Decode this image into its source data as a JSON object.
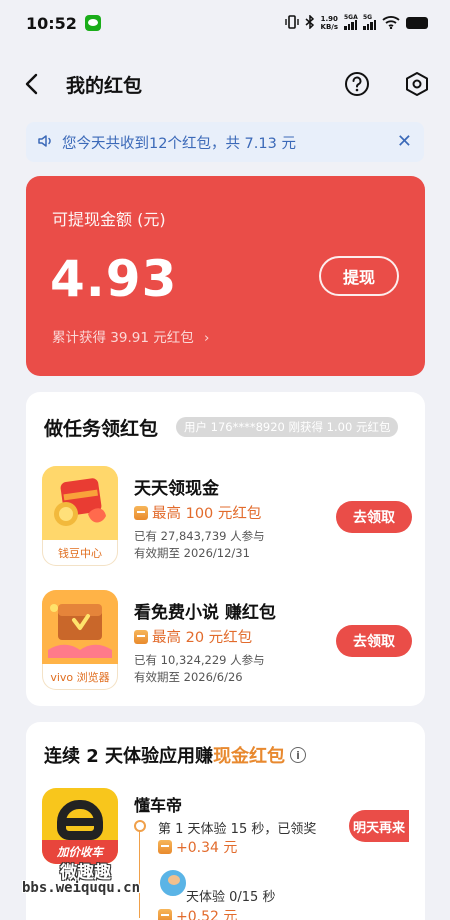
{
  "status_bar": {
    "time": "10:52",
    "net_speed": "1.90",
    "net_unit": "KB/s",
    "signal1": "5GA",
    "signal2": "5G"
  },
  "header": {
    "title": "我的红包"
  },
  "notice": {
    "text": "您今天共收到12个红包，共 7.13 元"
  },
  "balance": {
    "label": "可提现金额 (元)",
    "amount": "4.93",
    "withdraw_label": "提现",
    "accumulated_text": "累计获得 39.91 元红包"
  },
  "tasks": {
    "title": "做任务领红包",
    "ticker": "用户 176****8920 刚获得 1.00 元红包",
    "items": [
      {
        "icon_label": "钱豆中心",
        "name": "天天领现金",
        "reward": "最高 100 元红包",
        "participants": "已有 27,843,739 人参与",
        "validity": "有效期至 2026/12/31",
        "button": "去领取"
      },
      {
        "icon_label": "vivo 浏览器",
        "name": "看免费小说 赚红包",
        "reward": "最高 20 元红包",
        "participants": "已有 10,324,229 人参与",
        "validity": "有效期至 2026/6/26",
        "button": "去领取"
      }
    ]
  },
  "consecutive": {
    "title_prefix": "连续 2 天体验应用赚",
    "title_highlight": "现金红包",
    "app_name": "懂车帝",
    "app_banner": "加价收车",
    "day1_text": "第 1 天体验 15 秒，已领奖",
    "day1_reward": "+0.34 元",
    "day2_text": "天体验 0/15 秒",
    "day2_reward": "+0.52 元",
    "button": "明天再来"
  },
  "watermark": {
    "cn": "微趣趣",
    "url": "bbs.weiququ.cn"
  },
  "colors": {
    "accent_red": "#ea4d48",
    "reward_orange": "#e26b2c",
    "notice_blue": "#3b69b8",
    "background": "#f0f1f6"
  }
}
